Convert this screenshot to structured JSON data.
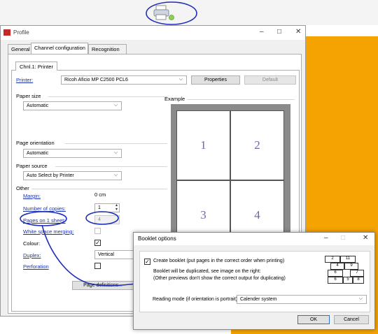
{
  "profile_window": {
    "title": "Profile",
    "tabs": [
      "General",
      "Channel configuration",
      "Recognition"
    ],
    "active_tab": "Channel configuration",
    "channel_tab": "Chnl.1: Printer",
    "printer_label": "Printer:",
    "printer_value": "Ricoh Aficio MP C2500 PCL6",
    "properties_button": "Properties",
    "default_button": "Default",
    "paper_size_label": "Paper size",
    "paper_size_value": "Automatic",
    "page_orientation_label": "Page orientation",
    "page_orientation_value": "Automatic",
    "paper_source_label": "Paper source",
    "paper_source_value": "Auto Select by Printer",
    "other_label": "Other",
    "margin_label": "Margin:",
    "margin_value": "0 cm",
    "copies_label": "Number of copies:",
    "copies_value": "1",
    "pages_label": "Pages on 1 sheet:",
    "pages_value": "4",
    "whitespace_label": "White space merging:",
    "colour_label": "Colour:",
    "colour_mark": "✓",
    "duplex_label": "Duplex:",
    "duplex_value": "Vertical",
    "perforation_label": "Perforation",
    "page_definitions_button": "Page definitions...",
    "example_label": "Example",
    "example_pages": [
      "1",
      "2",
      "3",
      "4"
    ]
  },
  "booklet_dialog": {
    "title": "Booklet options",
    "create_label": "Create booklet (put pages in the correct order when printing)",
    "create_mark": "✓",
    "info_line1": "Booklet will be duplicated, see image on the right:",
    "info_line2": "(Other previews don't show the correct output for duplicating)",
    "reading_mode_label": "Reading mode (if orientation is portrait):",
    "reading_mode_value": "Calender system",
    "ok_button": "OK",
    "cancel_button": "Cancel",
    "diagram_numbers": [
      "2",
      "11",
      "4",
      "9",
      "6",
      "7",
      "6",
      "5",
      "8"
    ]
  },
  "colors": {
    "annotation_blue": "#1f2fb8",
    "background_orange": "#f5a300",
    "link_blue": "#1a33b5"
  },
  "icons": [
    "printer-icon",
    "profile-app-icon",
    "minimize-icon",
    "maximize-icon",
    "close-icon",
    "chevron-down-icon"
  ]
}
